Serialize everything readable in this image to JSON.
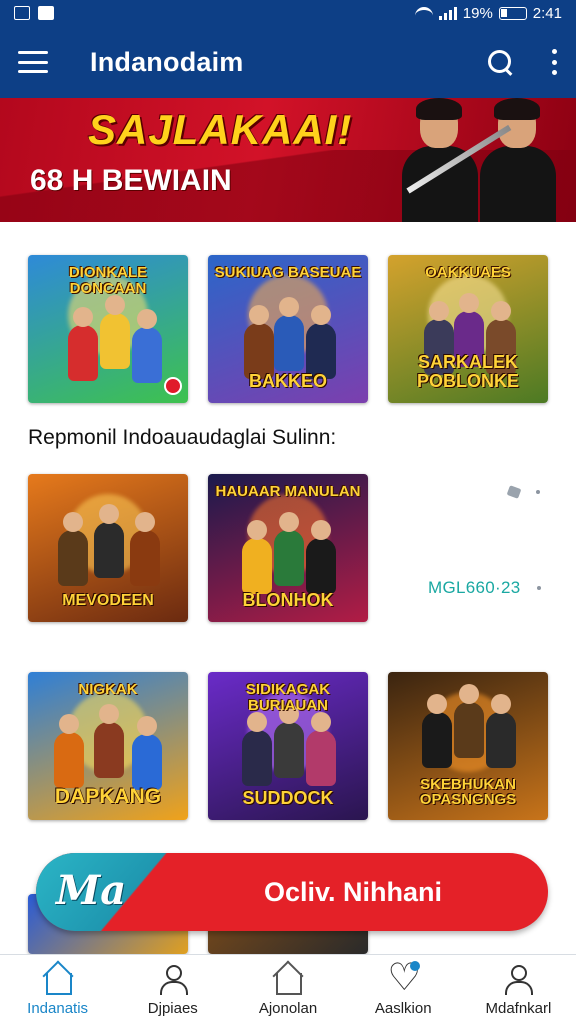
{
  "status_bar": {
    "battery_percent": "19%",
    "time": "2:41"
  },
  "app_bar": {
    "title": "Indanodaim"
  },
  "banner": {
    "title": "SAJLAKAAI!",
    "subtitle": "68 H BEWIAIN"
  },
  "games_row1": [
    {
      "title_top": "DIONKALE DONCAAN",
      "title_bottom": "",
      "colors": [
        "#2e8ad8",
        "#3ec24e"
      ]
    },
    {
      "title_top": "SUKIUAG BASEUAE",
      "title_bottom": "BAKKEO",
      "colors": [
        "#2b66c9",
        "#7c3fae"
      ]
    },
    {
      "title_top": "OAKKUAES",
      "title_bottom": "SARKALEK POBLONKE",
      "colors": [
        "#d4a22d",
        "#4c7a24"
      ]
    }
  ],
  "section": {
    "heading": "Repmonil Indoauaudaglai Sulinn:"
  },
  "games_row2": [
    {
      "title_top": "",
      "title_bottom": "MEVODEEN",
      "colors": [
        "#e67a1c",
        "#6b2a10"
      ]
    },
    {
      "title_top": "HAUAAR MANULAN",
      "title_bottom": "BLONHOK",
      "colors": [
        "#1a1a4d",
        "#b21c45"
      ]
    }
  ],
  "side_meta": "MGL660·23",
  "games_row3": [
    {
      "title_top": "NIGKAK",
      "title_bottom": "DAPKANG",
      "colors": [
        "#2f7fd6",
        "#f0a21a"
      ]
    },
    {
      "title_top": "SIDIKAGAK BURIAUAN",
      "title_bottom": "SUDDOCK",
      "colors": [
        "#6a2bc8",
        "#2a154f"
      ]
    },
    {
      "title_top": "",
      "title_bottom": "SKEBHUKAN OPASNGNGS",
      "colors": [
        "#3a2410",
        "#c8741a"
      ]
    }
  ],
  "cta": {
    "logo": "Ma",
    "label": "Ocliv. Nihhani",
    "colors": {
      "accent": "#e42128",
      "logo_bg": "#2bb5c6"
    }
  },
  "bottom_nav": [
    {
      "label": "Indanatis",
      "icon": "home-icon",
      "active": true
    },
    {
      "label": "Djpiaes",
      "icon": "user-icon",
      "active": false
    },
    {
      "label": "Ajonolan",
      "icon": "home-icon",
      "active": false
    },
    {
      "label": "Aaslkion",
      "icon": "heart-icon",
      "active": false
    },
    {
      "label": "Mdafnkarl",
      "icon": "user-icon",
      "active": false
    }
  ],
  "theme": {
    "primary": "#0d3f86",
    "active_nav": "#1a86c8"
  }
}
